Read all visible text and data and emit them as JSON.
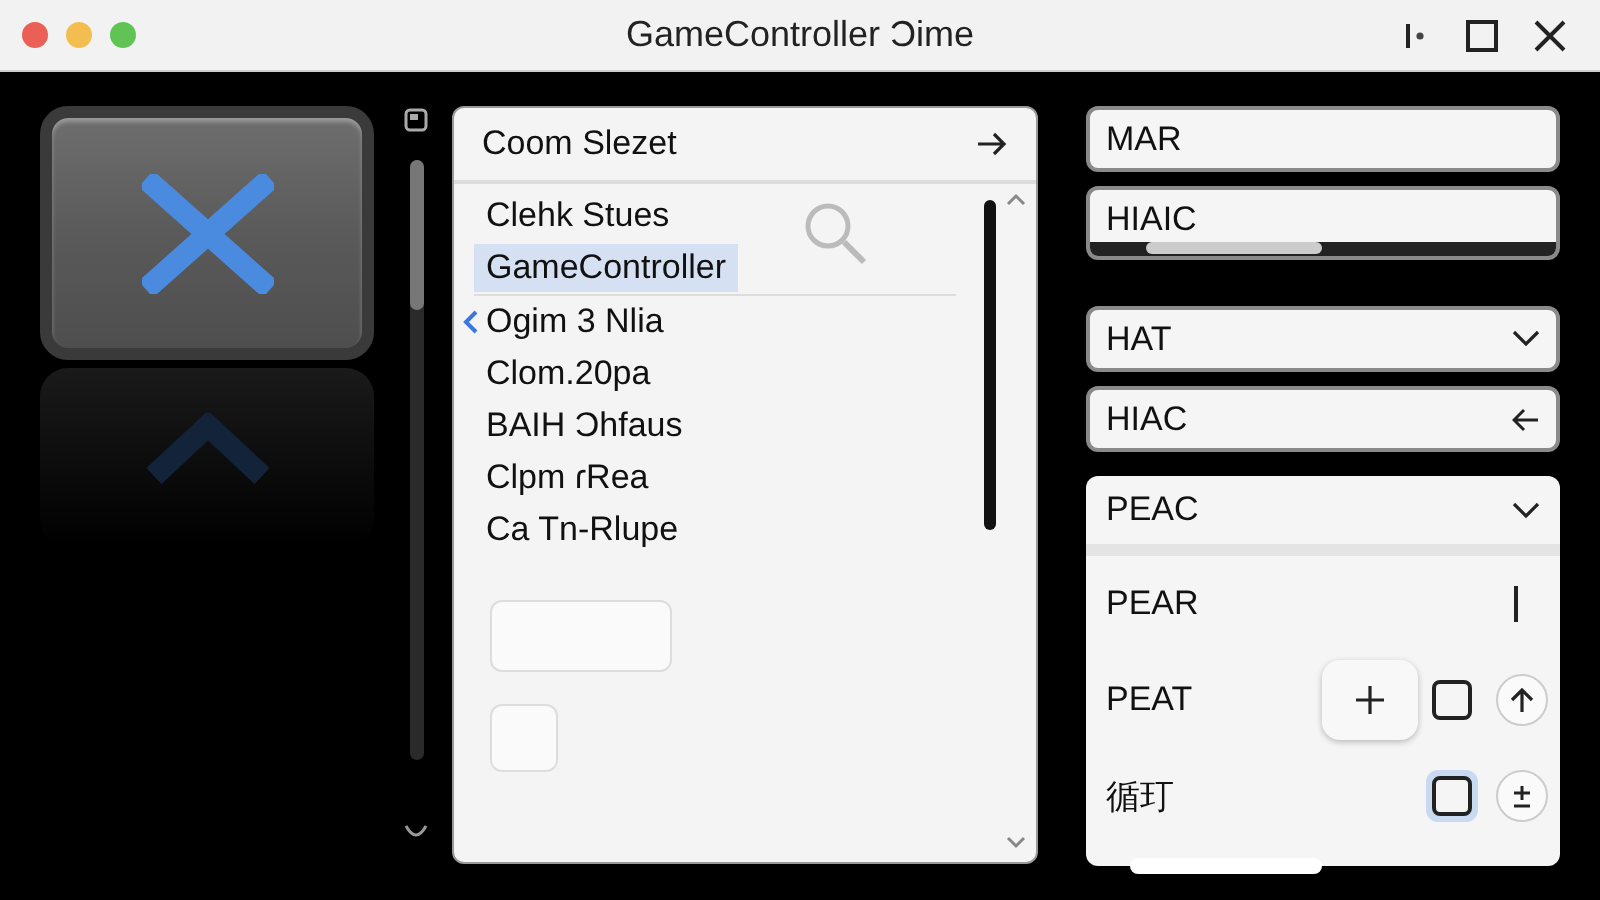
{
  "window": {
    "title": "GameController Ɔime"
  },
  "list_panel": {
    "header": "Coom Slezet",
    "items": [
      {
        "label": "Clehk Stues",
        "selected": false,
        "marked": false
      },
      {
        "label": "GameController",
        "selected": true,
        "marked": false
      },
      {
        "label": "Ogim 3 Nlia",
        "selected": false,
        "marked": true
      },
      {
        "label": "Clom.20pa",
        "selected": false,
        "marked": false
      },
      {
        "label": "BAIH Ɔhfaus",
        "selected": false,
        "marked": false
      },
      {
        "label": "Clpm ɾRea",
        "selected": false,
        "marked": false
      },
      {
        "label": "Ca Tn-Rlupe",
        "selected": false,
        "marked": false
      }
    ]
  },
  "fields": [
    {
      "kind": "text",
      "value": "MAR"
    },
    {
      "kind": "scroll",
      "value": "HIAIC"
    },
    {
      "kind": "dropdown",
      "value": "HAT"
    },
    {
      "kind": "back",
      "value": "HIAC"
    }
  ],
  "settings": {
    "header": "PEAC",
    "rows": [
      {
        "kind": "cursor",
        "label": "PEAR"
      },
      {
        "kind": "controls",
        "label": "PEAT",
        "checkbox": {
          "checked": false,
          "focused": false
        }
      },
      {
        "kind": "toggle",
        "label": "循玎",
        "checkbox": {
          "checked": false,
          "focused": true
        }
      }
    ]
  }
}
